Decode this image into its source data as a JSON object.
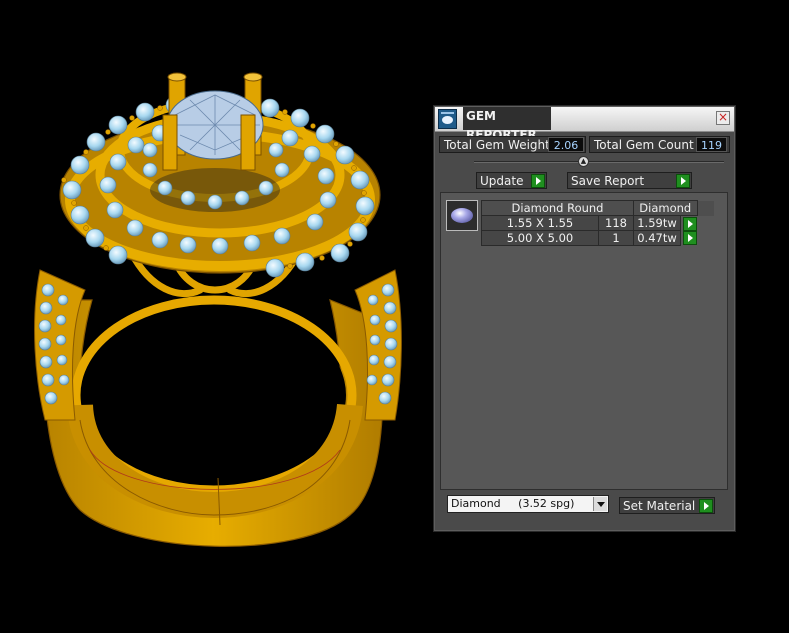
{
  "panel": {
    "title": "GEM REPORTER",
    "close_glyph": "×",
    "total_weight_label": "Total Gem Weight",
    "total_weight_value": "2.06",
    "total_count_label": "Total Gem Count",
    "total_count_value": "119",
    "update_label": "Update",
    "save_report_label": "Save Report",
    "gem_icon": "round-gem-icon",
    "table": {
      "header": [
        "Diamond Round",
        "Diamond"
      ],
      "rows": [
        {
          "size": "1.55 X 1.55",
          "count": "118",
          "weight": "1.59tw"
        },
        {
          "size": "5.00 X 5.00",
          "count": "1",
          "weight": "0.47tw"
        }
      ]
    },
    "material_value": "Diamond     (3.52 spg)",
    "set_material_label": "Set Material"
  },
  "colors": {
    "metal": "#E0A400",
    "gem": "#A8D8F0",
    "panel_bg": "#4A4A4A",
    "accent_green": "#1F8F1F",
    "value_text": "#A8D4FF"
  }
}
